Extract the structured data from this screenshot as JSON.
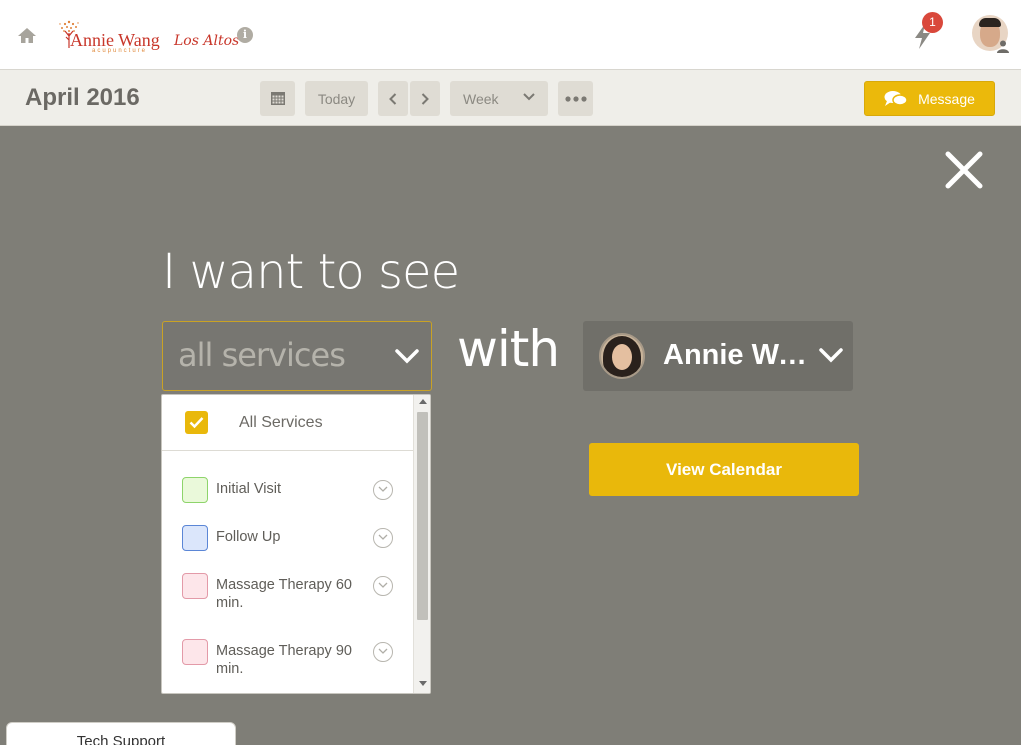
{
  "header": {
    "logo": {
      "name": "Annie Wang",
      "location": "Los Altos",
      "subtitle": "acupuncture"
    },
    "notifications": {
      "count": "1"
    },
    "icons": {
      "home": "home-icon",
      "info": "info-icon",
      "bolt": "lightning-bolt-icon",
      "user": "user-avatar"
    }
  },
  "toolbar": {
    "month_title": "April 2016",
    "today_label": "Today",
    "view_label": "Week",
    "message_label": "Message"
  },
  "overlay": {
    "headline": "I want to see",
    "services_value": "all services",
    "with_label": "with",
    "provider_name": "Annie Wang",
    "view_calendar_label": "View Calendar"
  },
  "dropdown": {
    "all_services_label": "All Services",
    "all_services_checked": true,
    "items": [
      {
        "label": "Initial Visit",
        "color": "#eaf9da",
        "border": "#8ed46b"
      },
      {
        "label": "Follow Up",
        "color": "#dbe6fb",
        "border": "#5b86d6"
      },
      {
        "label": "Massage Therapy 60 min.",
        "color": "#fde6ea",
        "border": "#e39aa8"
      },
      {
        "label": "Massage Therapy 90 min.",
        "color": "#fde6ea",
        "border": "#e39aa8"
      }
    ]
  },
  "tech_support_label": "Tech Support",
  "colors": {
    "accent": "#ebb90b",
    "overlay": "#7f7e77",
    "badge": "#d9483b"
  }
}
